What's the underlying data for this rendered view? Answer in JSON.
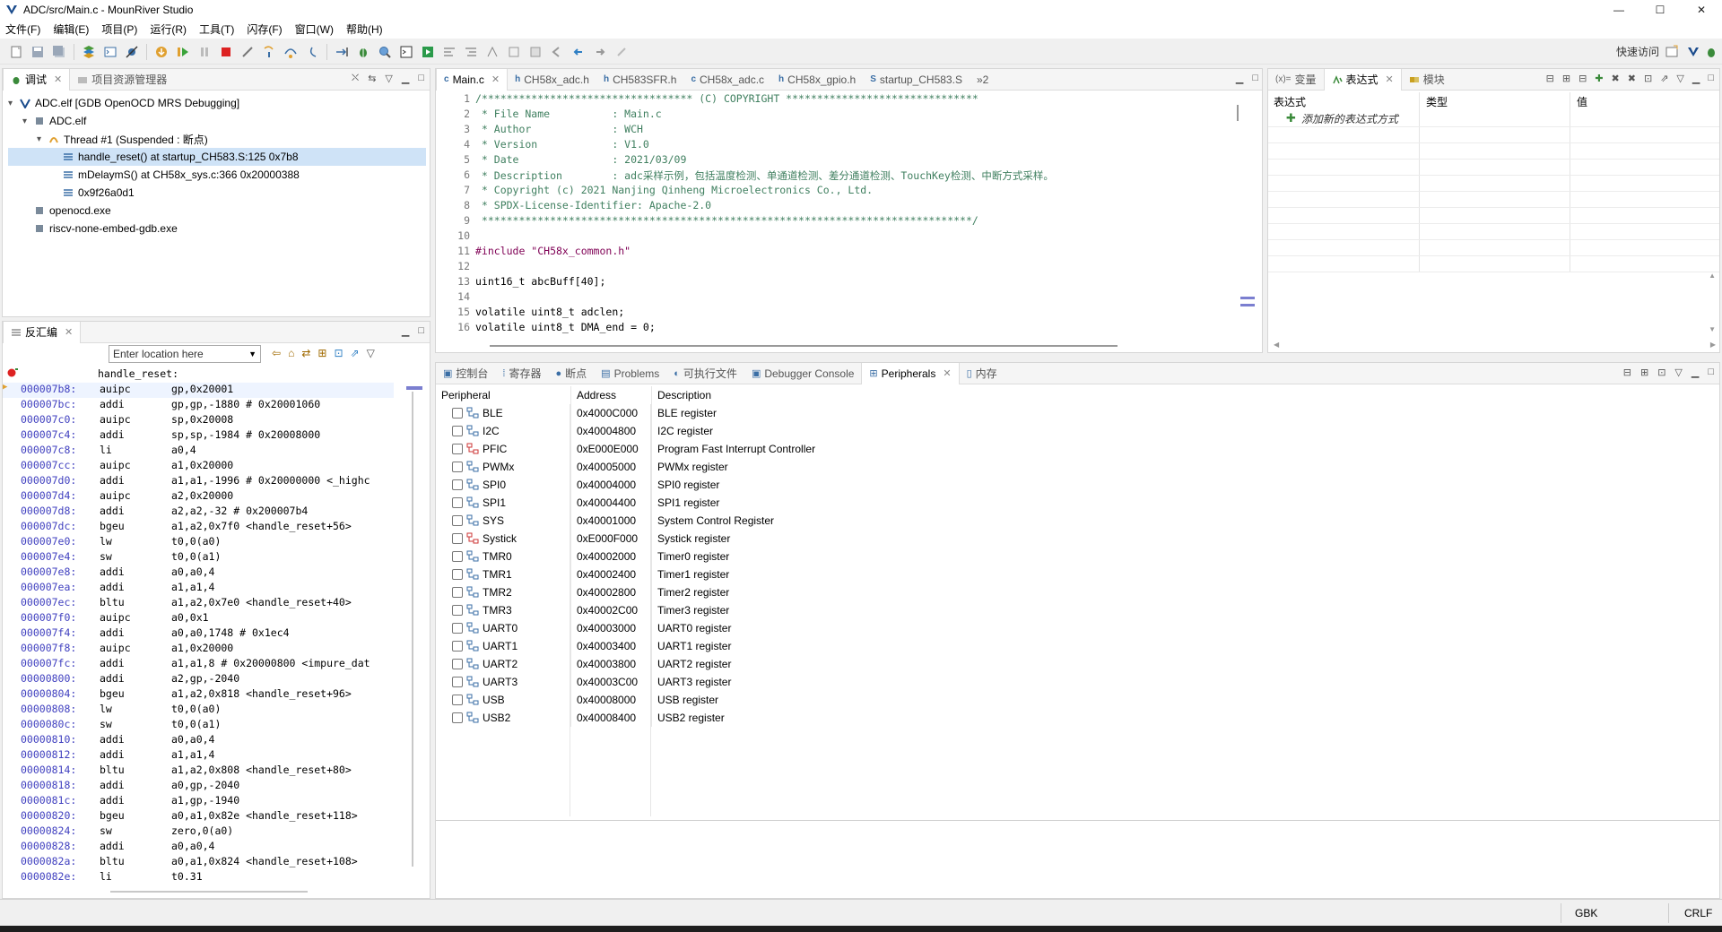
{
  "window": {
    "title": "ADC/src/Main.c - MounRiver Studio",
    "minimize": "—",
    "maximize": "☐",
    "close": "✕"
  },
  "menu": [
    "文件(F)",
    "编辑(E)",
    "项目(P)",
    "运行(R)",
    "工具(T)",
    "闪存(F)",
    "窗口(W)",
    "帮助(H)"
  ],
  "toolbar": {
    "quick_access": "快速访问"
  },
  "debug_view": {
    "tabs": [
      {
        "label": "调试",
        "active": true
      },
      {
        "label": "项目资源管理器",
        "active": false
      }
    ],
    "tree": [
      {
        "label": "ADC.elf [GDB OpenOCD MRS Debugging]",
        "indent": 0,
        "icon": "debug-launch-icon",
        "expander": "▾"
      },
      {
        "label": "ADC.elf",
        "indent": 1,
        "icon": "process-icon",
        "expander": "▾"
      },
      {
        "label": "Thread #1 (Suspended : 断点)",
        "indent": 2,
        "icon": "thread-icon",
        "expander": "▾"
      },
      {
        "label": "handle_reset() at startup_CH583.S:125 0x7b8",
        "indent": 3,
        "icon": "stack-frame-icon",
        "expander": "",
        "selected": true
      },
      {
        "label": "mDelaymS() at CH58x_sys.c:366 0x20000388",
        "indent": 3,
        "icon": "stack-frame-icon",
        "expander": ""
      },
      {
        "label": "0x9f26a0d1",
        "indent": 3,
        "icon": "stack-frame-icon",
        "expander": ""
      },
      {
        "label": "openocd.exe",
        "indent": 1,
        "icon": "process-icon",
        "expander": ""
      },
      {
        "label": "riscv-none-embed-gdb.exe",
        "indent": 1,
        "icon": "process-icon",
        "expander": ""
      }
    ]
  },
  "disassembly": {
    "tab_label": "反汇编",
    "location_placeholder": "Enter location here",
    "label": "handle_reset:",
    "lines": [
      {
        "addr": "000007b8:",
        "op": "auipc",
        "args": "gp,0x20001",
        "current": true
      },
      {
        "addr": "000007bc:",
        "op": "addi",
        "args": "gp,gp,-1880 # 0x20001060"
      },
      {
        "addr": "000007c0:",
        "op": "auipc",
        "args": "sp,0x20008"
      },
      {
        "addr": "000007c4:",
        "op": "addi",
        "args": "sp,sp,-1984 # 0x20008000"
      },
      {
        "addr": "000007c8:",
        "op": "li",
        "args": "a0,4"
      },
      {
        "addr": "000007cc:",
        "op": "auipc",
        "args": "a1,0x20000"
      },
      {
        "addr": "000007d0:",
        "op": "addi",
        "args": "a1,a1,-1996 # 0x20000000 <_highc"
      },
      {
        "addr": "000007d4:",
        "op": "auipc",
        "args": "a2,0x20000"
      },
      {
        "addr": "000007d8:",
        "op": "addi",
        "args": "a2,a2,-32 # 0x200007b4"
      },
      {
        "addr": "000007dc:",
        "op": "bgeu",
        "args": "a1,a2,0x7f0 <handle_reset+56>"
      },
      {
        "addr": "000007e0:",
        "op": "lw",
        "args": "t0,0(a0)"
      },
      {
        "addr": "000007e4:",
        "op": "sw",
        "args": "t0,0(a1)"
      },
      {
        "addr": "000007e8:",
        "op": "addi",
        "args": "a0,a0,4"
      },
      {
        "addr": "000007ea:",
        "op": "addi",
        "args": "a1,a1,4"
      },
      {
        "addr": "000007ec:",
        "op": "bltu",
        "args": "a1,a2,0x7e0 <handle_reset+40>"
      },
      {
        "addr": "000007f0:",
        "op": "auipc",
        "args": "a0,0x1"
      },
      {
        "addr": "000007f4:",
        "op": "addi",
        "args": "a0,a0,1748 # 0x1ec4"
      },
      {
        "addr": "000007f8:",
        "op": "auipc",
        "args": "a1,0x20000"
      },
      {
        "addr": "000007fc:",
        "op": "addi",
        "args": "a1,a1,8 # 0x20000800 <impure_dat"
      },
      {
        "addr": "00000800:",
        "op": "addi",
        "args": "a2,gp,-2040"
      },
      {
        "addr": "00000804:",
        "op": "bgeu",
        "args": "a1,a2,0x818 <handle_reset+96>"
      },
      {
        "addr": "00000808:",
        "op": "lw",
        "args": "t0,0(a0)"
      },
      {
        "addr": "0000080c:",
        "op": "sw",
        "args": "t0,0(a1)"
      },
      {
        "addr": "00000810:",
        "op": "addi",
        "args": "a0,a0,4"
      },
      {
        "addr": "00000812:",
        "op": "addi",
        "args": "a1,a1,4"
      },
      {
        "addr": "00000814:",
        "op": "bltu",
        "args": "a1,a2,0x808 <handle_reset+80>"
      },
      {
        "addr": "00000818:",
        "op": "addi",
        "args": "a0,gp,-2040"
      },
      {
        "addr": "0000081c:",
        "op": "addi",
        "args": "a1,gp,-1940"
      },
      {
        "addr": "00000820:",
        "op": "bgeu",
        "args": "a0,a1,0x82e <handle_reset+118>"
      },
      {
        "addr": "00000824:",
        "op": "sw",
        "args": "zero,0(a0)"
      },
      {
        "addr": "00000828:",
        "op": "addi",
        "args": "a0,a0,4"
      },
      {
        "addr": "0000082a:",
        "op": "bltu",
        "args": "a0,a1,0x824 <handle_reset+108>"
      },
      {
        "addr": "0000082e:",
        "op": "li",
        "args": "t0.31"
      }
    ]
  },
  "editor": {
    "tabs": [
      {
        "label": "Main.c",
        "active": true
      },
      {
        "label": "CH58x_adc.h",
        "active": false
      },
      {
        "label": "CH583SFR.h",
        "active": false
      },
      {
        "label": "CH58x_adc.c",
        "active": false
      },
      {
        "label": "CH58x_gpio.h",
        "active": false
      },
      {
        "label": "startup_CH583.S",
        "active": false
      }
    ],
    "overflow": "»2",
    "lines": [
      {
        "n": "1",
        "text": "/********************************** (C) COPYRIGHT *******************************",
        "kind": "comment"
      },
      {
        "n": "2",
        "text": " * File Name          : Main.c",
        "kind": "comment"
      },
      {
        "n": "3",
        "text": " * Author             : WCH",
        "kind": "comment"
      },
      {
        "n": "4",
        "text": " * Version            : V1.0",
        "kind": "comment"
      },
      {
        "n": "5",
        "text": " * Date               : 2021/03/09",
        "kind": "comment"
      },
      {
        "n": "6",
        "text": " * Description        : adc采样示例，包括温度检测、单通道检测、差分通道检测、TouchKey检测、中断方式采样。",
        "kind": "comment"
      },
      {
        "n": "7",
        "text": " * Copyright (c) 2021 Nanjing Qinheng Microelectronics Co., Ltd.",
        "kind": "comment"
      },
      {
        "n": "8",
        "text": " * SPDX-License-Identifier: Apache-2.0",
        "kind": "comment"
      },
      {
        "n": "9",
        "text": " *******************************************************************************/",
        "kind": "comment"
      },
      {
        "n": "10",
        "text": "",
        "kind": "blank"
      },
      {
        "n": "11",
        "text": "#include \"CH58x_common.h\"",
        "kind": "include"
      },
      {
        "n": "12",
        "text": "",
        "kind": "blank"
      },
      {
        "n": "13",
        "text": "uint16_t abcBuff[40];",
        "kind": "code"
      },
      {
        "n": "14",
        "text": "",
        "kind": "blank"
      },
      {
        "n": "15",
        "text": "volatile uint8_t adclen;",
        "kind": "code"
      },
      {
        "n": "16",
        "text": "volatile uint8_t DMA_end = 0;",
        "kind": "code"
      }
    ]
  },
  "expressions": {
    "tabs": [
      {
        "label": "变量",
        "active": false
      },
      {
        "label": "表达式",
        "active": true
      },
      {
        "label": "模块",
        "active": false
      }
    ],
    "columns": [
      "表达式",
      "类型",
      "值"
    ],
    "add_new": "添加新的表达式方式"
  },
  "bottom_panel": {
    "tabs": [
      {
        "label": "控制台",
        "active": false
      },
      {
        "label": "寄存器",
        "active": false
      },
      {
        "label": "断点",
        "active": false
      },
      {
        "label": "Problems",
        "active": false
      },
      {
        "label": "可执行文件",
        "active": false
      },
      {
        "label": "Debugger Console",
        "active": false
      },
      {
        "label": "Peripherals",
        "active": true
      },
      {
        "label": "内存",
        "active": false
      }
    ],
    "columns": [
      "Peripheral",
      "Address",
      "Description"
    ],
    "rows": [
      {
        "name": "BLE",
        "address": "0x4000C000",
        "description": "BLE register",
        "icon": "register-group-icon"
      },
      {
        "name": "I2C",
        "address": "0x40004800",
        "description": "I2C register",
        "icon": "register-group-icon"
      },
      {
        "name": "PFIC",
        "address": "0xE000E000",
        "description": "Program Fast Interrupt Controller",
        "icon": "register-group-red-icon"
      },
      {
        "name": "PWMx",
        "address": "0x40005000",
        "description": "PWMx register",
        "icon": "register-group-icon"
      },
      {
        "name": "SPI0",
        "address": "0x40004000",
        "description": "SPI0 register",
        "icon": "register-group-icon"
      },
      {
        "name": "SPI1",
        "address": "0x40004400",
        "description": "SPI1 register",
        "icon": "register-group-icon"
      },
      {
        "name": "SYS",
        "address": "0x40001000",
        "description": "System Control Register",
        "icon": "register-group-icon"
      },
      {
        "name": "Systick",
        "address": "0xE000F000",
        "description": "Systick register",
        "icon": "register-group-red-icon"
      },
      {
        "name": "TMR0",
        "address": "0x40002000",
        "description": "Timer0 register",
        "icon": "register-group-icon"
      },
      {
        "name": "TMR1",
        "address": "0x40002400",
        "description": "Timer1 register",
        "icon": "register-group-icon"
      },
      {
        "name": "TMR2",
        "address": "0x40002800",
        "description": "Timer2 register",
        "icon": "register-group-icon"
      },
      {
        "name": "TMR3",
        "address": "0x40002C00",
        "description": "Timer3 register",
        "icon": "register-group-icon"
      },
      {
        "name": "UART0",
        "address": "0x40003000",
        "description": "UART0 register",
        "icon": "register-group-icon"
      },
      {
        "name": "UART1",
        "address": "0x40003400",
        "description": "UART1 register",
        "icon": "register-group-icon"
      },
      {
        "name": "UART2",
        "address": "0x40003800",
        "description": "UART2 register",
        "icon": "register-group-icon"
      },
      {
        "name": "UART3",
        "address": "0x40003C00",
        "description": "UART3 register",
        "icon": "register-group-icon"
      },
      {
        "name": "USB",
        "address": "0x40008000",
        "description": "USB register",
        "icon": "register-group-icon"
      },
      {
        "name": "USB2",
        "address": "0x40008400",
        "description": "USB2 register",
        "icon": "register-group-icon"
      }
    ]
  },
  "status": {
    "encoding": "GBK",
    "line_ending": "CRLF"
  },
  "colors": {
    "comment": "#3f7f5f",
    "keyword": "#7f0055",
    "string": "#2a00ff",
    "address": "#3f3fbf",
    "selection": "#cfe3f7",
    "accent": "#1e6fd9"
  }
}
